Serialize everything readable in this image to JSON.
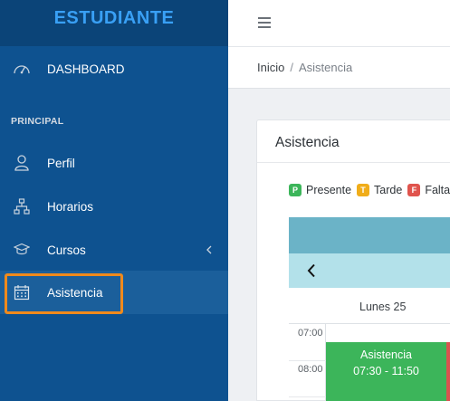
{
  "sidebar": {
    "brand": "ESTUDIANTE",
    "dashboard_label": "DASHBOARD",
    "section_title": "PRINCIPAL",
    "items": [
      {
        "label": "Perfil",
        "icon": "user-icon"
      },
      {
        "label": "Horarios",
        "icon": "sitemap-icon"
      },
      {
        "label": "Cursos",
        "icon": "graduation-cap-icon",
        "has_submenu": true
      },
      {
        "label": "Asistencia",
        "icon": "calendar-icon",
        "active": true
      }
    ]
  },
  "header": {
    "menu_icon": "hamburger-icon"
  },
  "breadcrumb": {
    "home": "Inicio",
    "separator": "/",
    "current": "Asistencia"
  },
  "card": {
    "title": "Asistencia",
    "legend": [
      {
        "letter": "P",
        "label": "Presente",
        "color": "#3cb55a"
      },
      {
        "letter": "T",
        "label": "Tarde",
        "color": "#f0ad1a"
      },
      {
        "letter": "F",
        "label": "Falta",
        "color": "#e0544d"
      }
    ],
    "calendar": {
      "day_header": "Lunes 25",
      "times": [
        "07:00",
        "08:00"
      ],
      "event": {
        "title": "Asistencia",
        "time": "07:30 - 11:50",
        "color": "#3cb55a"
      }
    }
  },
  "colors": {
    "sidebar_bg": "#0e5290",
    "brand_bg": "#0b4478",
    "brand_text": "#39a0f5",
    "highlight": "#f08a1c"
  }
}
